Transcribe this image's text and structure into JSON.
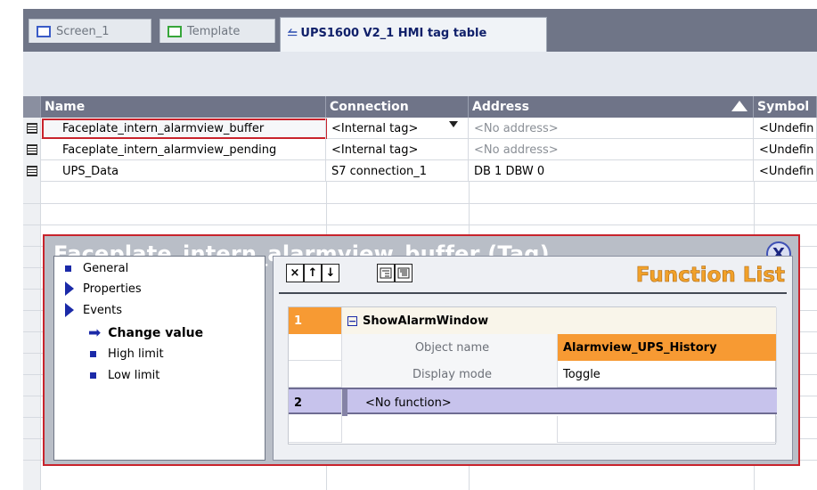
{
  "tabs": [
    {
      "label": "Screen_1"
    },
    {
      "label": "Template"
    },
    {
      "label": "UPS1600 V2_1 HMI tag table"
    }
  ],
  "table": {
    "columns": [
      "Name",
      "Connection",
      "Address",
      "Symbol"
    ],
    "rows": [
      {
        "name": "Faceplate_intern_alarmview_buffer",
        "connection": "<Internal tag>",
        "address": "<No address>",
        "symbol": "<Undefin"
      },
      {
        "name": "Faceplate_intern_alarmview_pending",
        "connection": "<Internal tag>",
        "address": "<No address>",
        "symbol": "<Undefin"
      },
      {
        "name": "UPS_Data",
        "connection": "S7 connection_1",
        "address": "DB 1 DBW 0",
        "symbol": "<Undefin"
      }
    ]
  },
  "popup": {
    "title": "Faceplate_intern_alarmview_buffer (Tag)",
    "close_glyph": "X",
    "tree": {
      "general": "General",
      "properties": "Properties",
      "events": "Events",
      "change_value": "Change value",
      "high_limit": "High limit",
      "low_limit": "Low limit"
    },
    "function_list": {
      "title": "Function List",
      "toolbar": [
        "×",
        "↑",
        "↓"
      ],
      "fn1_num": "1",
      "fn1_name": "ShowAlarmWindow",
      "param1_label": "Object name",
      "param1_value": "Alarmview_UPS_History",
      "param2_label": "Display mode",
      "param2_value": "Toggle",
      "fn2_num": "2",
      "fn2_name": "<No function>"
    }
  },
  "colors": {
    "accent_red": "#c8232c",
    "header_gray": "#6f7488",
    "function_list_orange": "#f1a12a",
    "highlight_orange": "#f79a33",
    "lilac": "#c7c3ec"
  }
}
